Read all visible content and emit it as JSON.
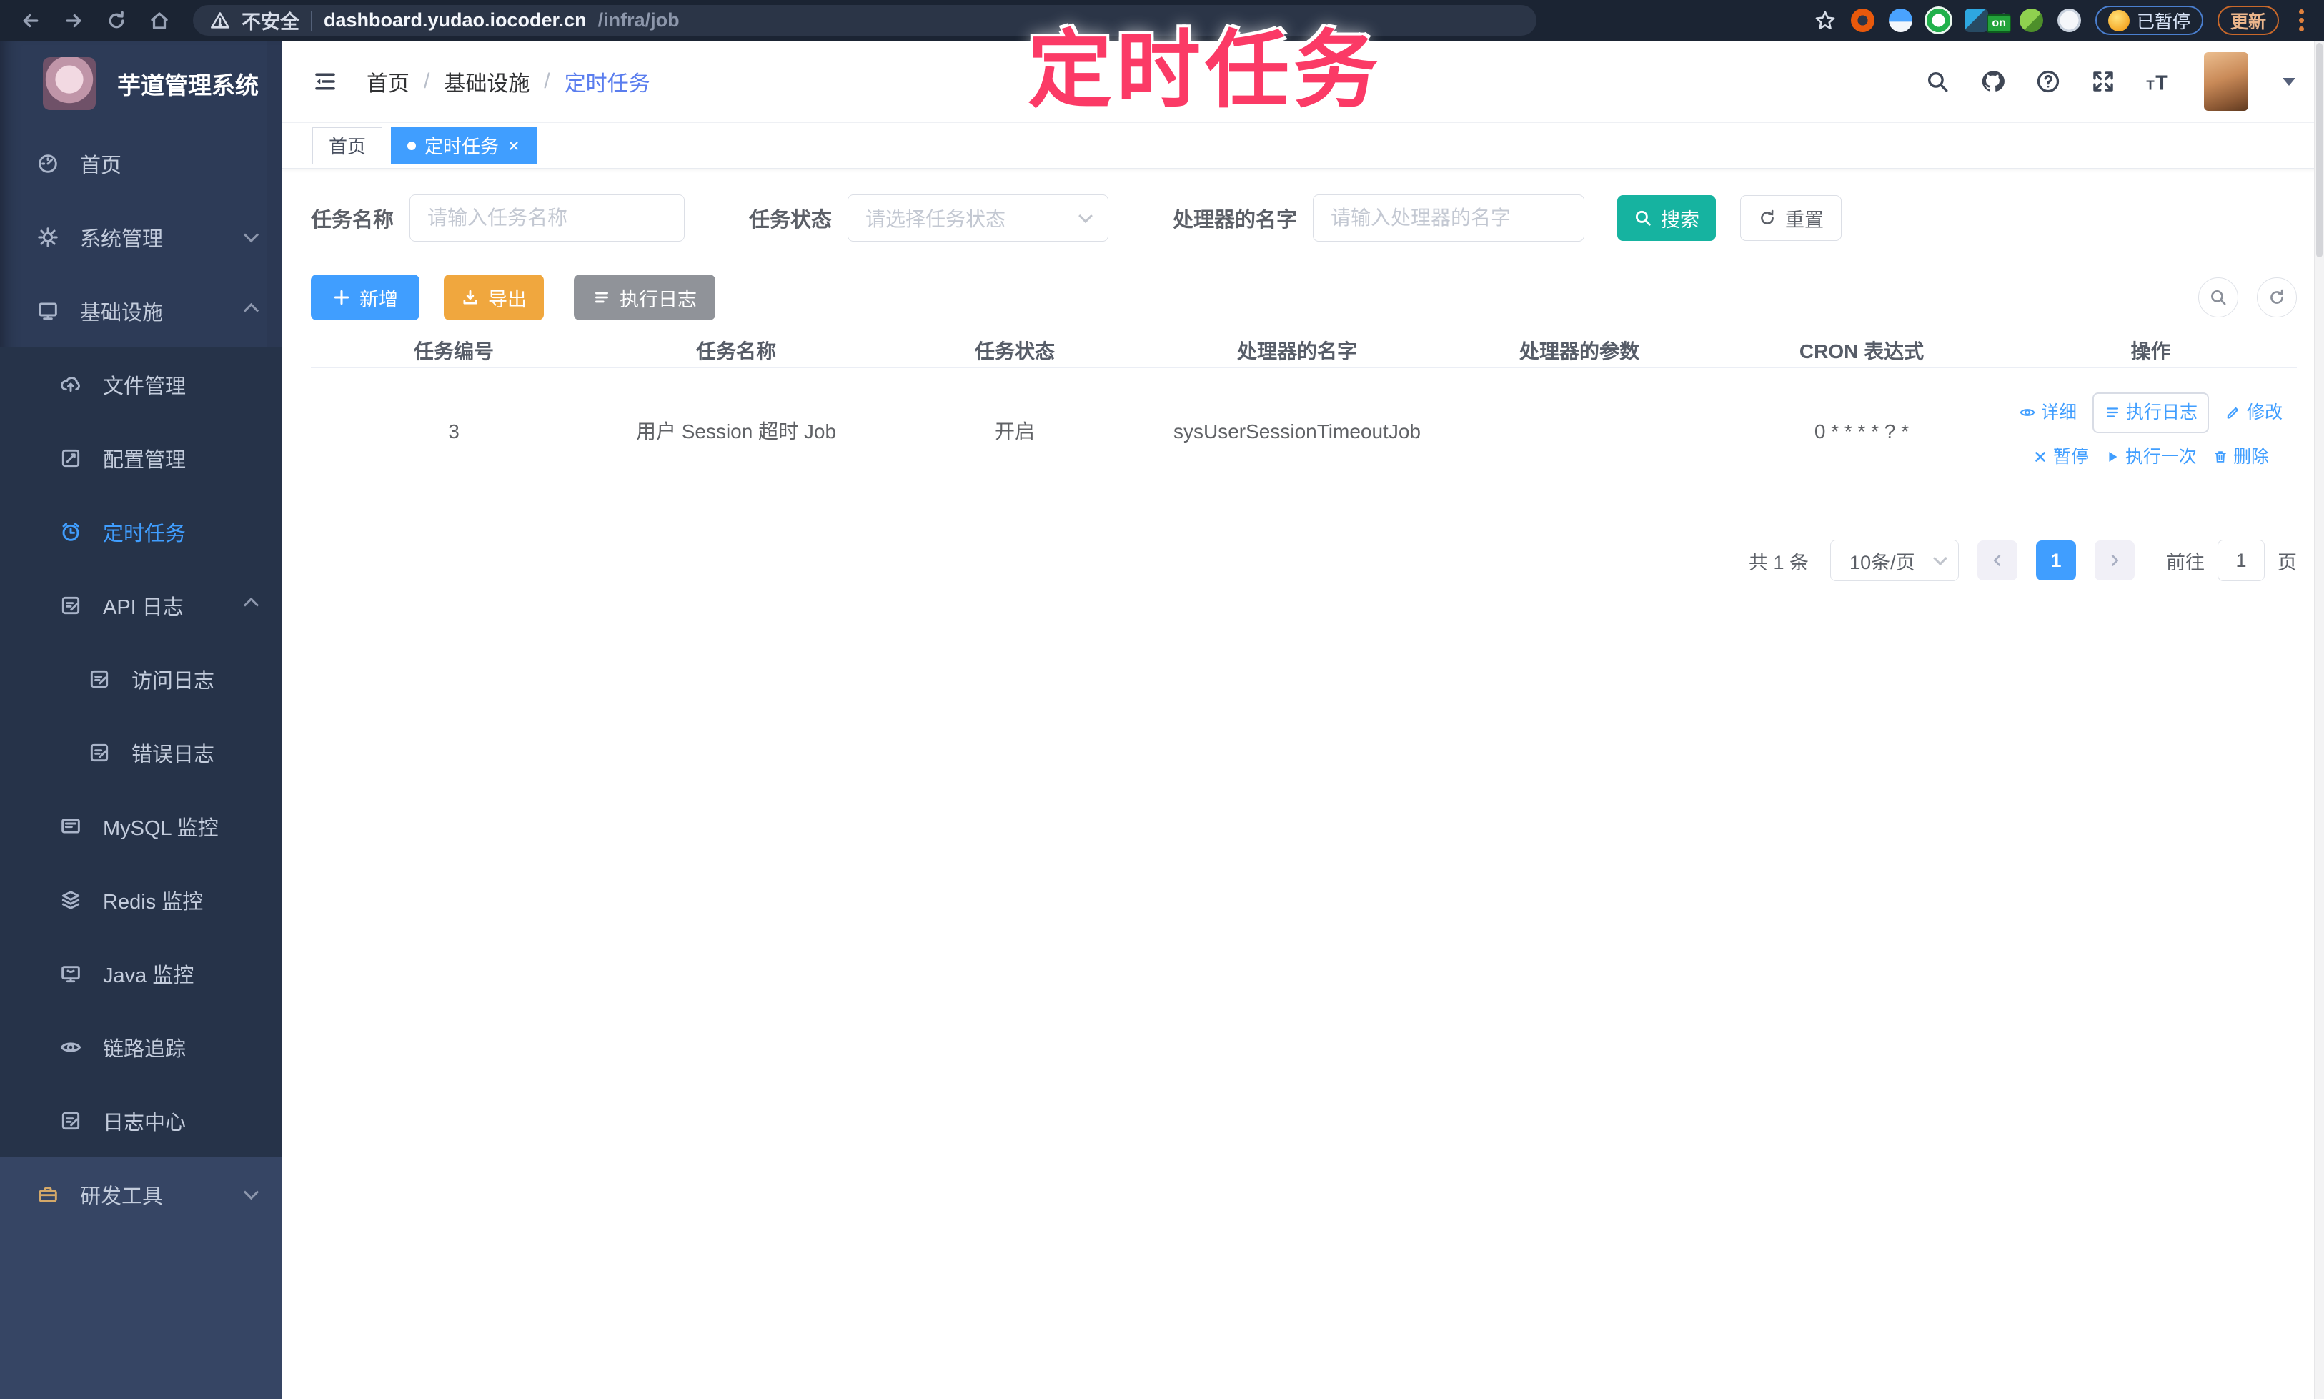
{
  "browser": {
    "security_label": "不安全",
    "url_host": "dashboard.yudao.iocoder.cn",
    "url_path": "/infra/job",
    "on_badge": "on",
    "paused_badge": "已暂停",
    "update_button": "更新"
  },
  "watermark": "定时任务",
  "sidebar": {
    "title": "芋道管理系统",
    "items": [
      {
        "label": "首页"
      },
      {
        "label": "系统管理"
      },
      {
        "label": "基础设施"
      },
      {
        "label": "文件管理"
      },
      {
        "label": "配置管理"
      },
      {
        "label": "定时任务"
      },
      {
        "label": "API 日志"
      },
      {
        "label": "访问日志"
      },
      {
        "label": "错误日志"
      },
      {
        "label": "MySQL 监控"
      },
      {
        "label": "Redis 监控"
      },
      {
        "label": "Java 监控"
      },
      {
        "label": "链路追踪"
      },
      {
        "label": "日志中心"
      },
      {
        "label": "研发工具"
      }
    ]
  },
  "header": {
    "breadcrumb": [
      "首页",
      "基础设施",
      "定时任务"
    ],
    "separator": "/"
  },
  "tabs": [
    {
      "label": "首页"
    },
    {
      "label": "定时任务"
    }
  ],
  "filters": {
    "name_label": "任务名称",
    "name_placeholder": "请输入任务名称",
    "status_label": "任务状态",
    "status_placeholder": "请选择任务状态",
    "handler_label": "处理器的名字",
    "handler_placeholder": "请输入处理器的名字",
    "search_button": "搜索",
    "reset_button": "重置"
  },
  "toolbar": {
    "add_button": "新增",
    "export_button": "导出",
    "log_button": "执行日志"
  },
  "table": {
    "headers": [
      "任务编号",
      "任务名称",
      "任务状态",
      "处理器的名字",
      "处理器的参数",
      "CRON 表达式",
      "操作"
    ],
    "rows": [
      {
        "id": "3",
        "name": "用户 Session 超时 Job",
        "status": "开启",
        "handler": "sysUserSessionTimeoutJob",
        "param": "",
        "cron": "0 * * * * ? *"
      }
    ],
    "row_actions": [
      "详细",
      "执行日志",
      "修改",
      "暂停",
      "执行一次",
      "删除"
    ]
  },
  "pagination": {
    "total": "共 1 条",
    "page_size": "10条/页",
    "current_page": "1",
    "goto_label": "前往",
    "goto_value": "1",
    "page_unit": "页"
  },
  "colors": {
    "accent": "#409eff",
    "search_teal": "#16b3a0",
    "export_orange": "#f0a73e",
    "info_gray": "#909399",
    "watermark_pink": "#fb3a66",
    "sidebar_bg": "#2d3b57"
  }
}
